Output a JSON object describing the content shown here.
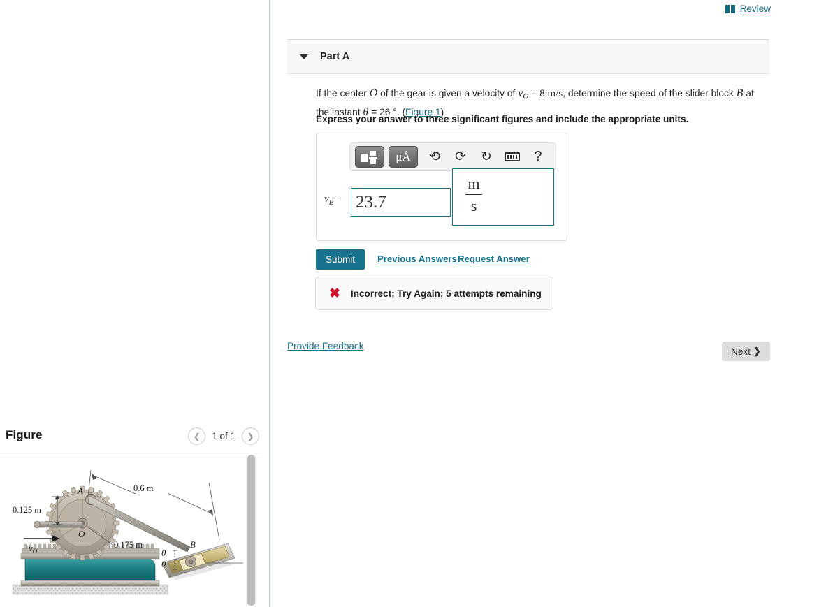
{
  "review": {
    "label": "Review",
    "icon": "book-icon",
    "color": "#136b85"
  },
  "part": {
    "title": "Part A",
    "caret_icon": "caret-down-icon"
  },
  "question": {
    "line1_a": "If the center ",
    "var_O": "O",
    "line1_b": " of the gear is given a velocity of ",
    "var_vO": "v",
    "var_vO_sub": "O",
    "eq1": " = 8 ",
    "unit_ms": "m/s",
    "line1_c": ", determine the speed of the slider block ",
    "var_B": "B",
    "line1_d": " at the instant ",
    "var_theta": "θ",
    "eq2": " = 26 °. (",
    "figure_link": "Figure 1",
    "line1_e": ")",
    "instruction": "Express your answer to three significant figures and include the appropriate units."
  },
  "answer": {
    "toolbar": {
      "fraction_button": "fraction-template-button",
      "units_button": "μÅ",
      "undo_icon": "undo-icon",
      "redo_icon": "redo-icon",
      "reset_icon": "reset-icon",
      "keyboard_icon": "keyboard-icon",
      "help_icon": "?"
    },
    "label_var": "v",
    "label_sub": "B",
    "label_eq": "=",
    "value": "23.7",
    "unit_numerator": "m",
    "unit_denominator": "s"
  },
  "actions": {
    "submit": "Submit",
    "previous_answers": "Previous Answers",
    "request_answer": "Request Answer"
  },
  "feedback": {
    "icon": "x-mark-icon",
    "message": "Incorrect; Try Again; 5 attempts remaining",
    "icon_color": "#d1102a"
  },
  "footer": {
    "provide_feedback": "Provide Feedback",
    "next": "Next",
    "next_icon": "chevron-right-icon"
  },
  "figure_panel": {
    "title": "Figure",
    "prev_icon": "chevron-left-icon",
    "next_icon": "chevron-right-icon",
    "counter": "1 of 1"
  },
  "figure_diagram": {
    "label_A": "A",
    "label_B": "B",
    "label_O": "O",
    "label_vO": "v",
    "label_vO_sub": "O",
    "dim_radius_small": "0.125 m",
    "dim_radius_large": "0.175 m",
    "dim_link": "0.6 m",
    "angle_theta_1": "θ",
    "angle_theta_2": "θ",
    "colors": {
      "gear_body": "#b9b0a4",
      "gear_dark": "#8e867a",
      "rack_metal": "#b0aca4",
      "base_teal": "#1f7f83",
      "ground": "#d8d8d8",
      "block_gold": "#b8a866"
    }
  }
}
